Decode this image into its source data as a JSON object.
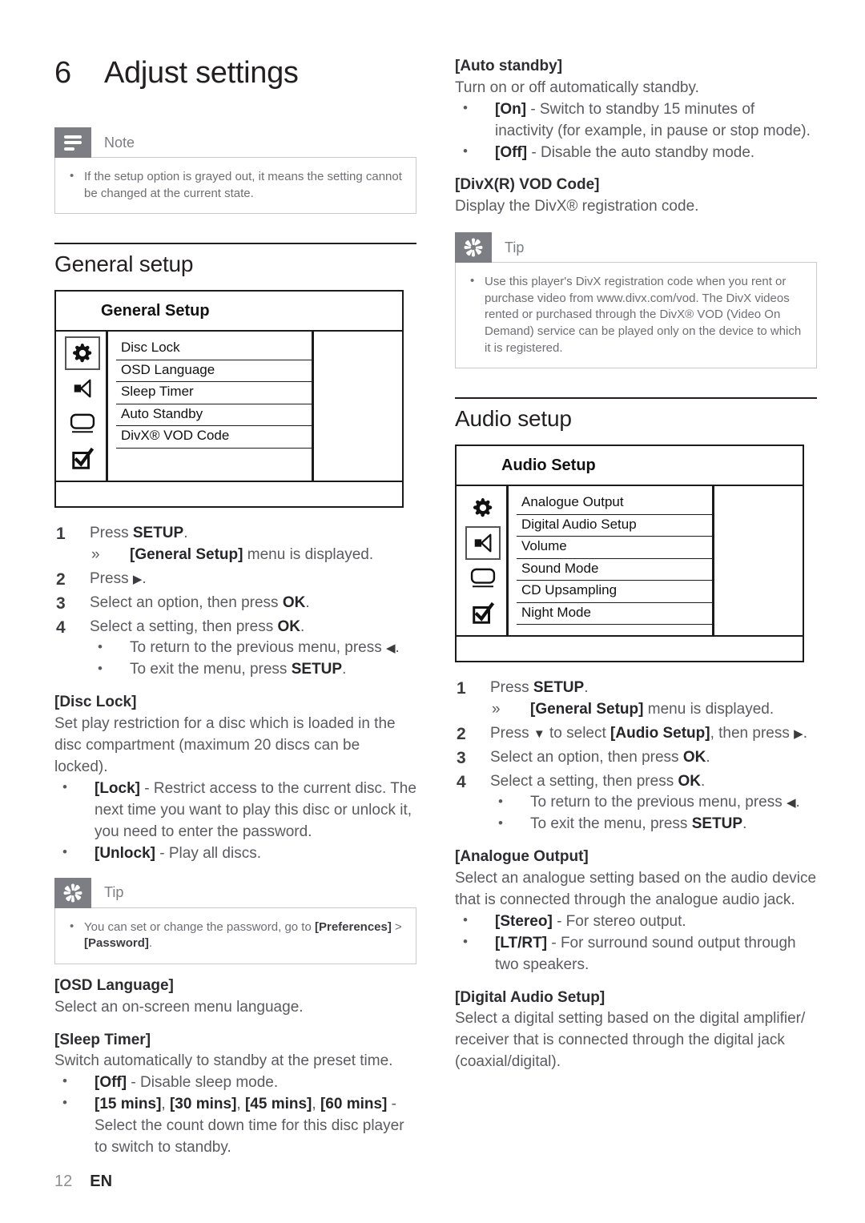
{
  "chapter": {
    "number": "6",
    "title": "Adjust settings"
  },
  "footer": {
    "page": "12",
    "language": "EN"
  },
  "note": {
    "label": "Note",
    "icon": "note-lines-icon",
    "items": [
      "If the setup option is grayed out, it means the setting cannot be changed at the current state."
    ]
  },
  "general_section": {
    "title": "General setup",
    "osd": {
      "title": "General Setup",
      "selected_icon_index": 0,
      "icons": [
        "gear-icon",
        "speaker-icon",
        "display-icon",
        "preferences-checkbox-icon"
      ],
      "items": [
        "Disc Lock",
        "OSD Language",
        "Sleep Timer",
        "Auto Standby",
        "DivX® VOD Code"
      ]
    },
    "steps": [
      {
        "text_html": "Press <b>SETUP</b>.",
        "subs": [
          {
            "marker": "»",
            "text_html": "<b>[General Setup]</b> menu is displayed."
          }
        ]
      },
      {
        "text_html": "Press <span class=\"arrow\">▶</span>.",
        "subs": []
      },
      {
        "text_html": "Select an option, then press <b>OK</b>.",
        "subs": []
      },
      {
        "text_html": "Select a setting, then press <b>OK</b>.",
        "subs": [
          {
            "marker": "•",
            "text_html": "To return to the previous menu, press <span class=\"arrow\">◀</span>."
          },
          {
            "marker": "•",
            "text_html": "To exit the menu, press <b>SETUP</b>."
          }
        ]
      }
    ],
    "options": [
      {
        "head": "[Disc Lock]",
        "body": "Set play restriction for a disc which is loaded in the disc compartment (maximum 20 discs can be locked).",
        "bullets": [
          "<b>[Lock]</b> - Restrict access to the current disc. The next time you want to play this disc or unlock it, you need to enter the password.",
          "<b>[Unlock]</b> - Play all discs."
        ]
      }
    ],
    "tip": {
      "label": "Tip",
      "icon": "starburst-icon",
      "items": [
        "You can set or change the password, go to <b>[Preferences]</b> > <b>[Password]</b>."
      ]
    },
    "options_after_tip": [
      {
        "head": "[OSD Language]",
        "body": "Select an on-screen menu language.",
        "bullets": []
      },
      {
        "head": "[Sleep Timer]",
        "body": "Switch automatically to standby at the preset time.",
        "bullets": [
          "<b>[Off]</b> - Disable sleep mode.",
          "<b>[15 mins]</b>, <b>[30 mins]</b>, <b>[45 mins]</b>, <b>[60 mins]</b> -Select the count down time for this disc player to switch to standby."
        ]
      }
    ]
  },
  "right_column": {
    "options_top": [
      {
        "head": "[Auto standby]",
        "body": "Turn on or off automatically standby.",
        "bullets": [
          "<b>[On]</b> - Switch to standby 15 minutes of inactivity (for example, in pause or stop mode).",
          "<b>[Off]</b> - Disable the auto standby mode."
        ]
      },
      {
        "head": "[DivX(R) VOD Code]",
        "body": "Display the DivX® registration code.",
        "bullets": []
      }
    ],
    "tip": {
      "label": "Tip",
      "icon": "starburst-icon",
      "items": [
        "Use this player's DivX registration code when you rent or purchase video from www.divx.com/vod. The DivX videos rented or purchased through the DivX® VOD (Video On Demand) service can be played only on the device to which it is registered."
      ]
    }
  },
  "audio_section": {
    "title": "Audio setup",
    "osd": {
      "title": "Audio Setup",
      "selected_icon_index": 1,
      "icons": [
        "gear-icon",
        "speaker-icon",
        "display-icon",
        "preferences-checkbox-icon"
      ],
      "items": [
        "Analogue Output",
        "Digital Audio Setup",
        "Volume",
        "Sound Mode",
        "CD Upsampling",
        "Night Mode"
      ]
    },
    "steps": [
      {
        "text_html": "Press <b>SETUP</b>.",
        "subs": [
          {
            "marker": "»",
            "text_html": "<b>[General Setup]</b> menu is displayed."
          }
        ]
      },
      {
        "text_html": "Press <span class=\"arrow\">▼</span> to select <b>[Audio Setup]</b>, then press <span class=\"arrow\">▶</span>.",
        "subs": []
      },
      {
        "text_html": "Select an option, then press <b>OK</b>.",
        "subs": []
      },
      {
        "text_html": "Select a setting, then press <b>OK</b>.",
        "subs": [
          {
            "marker": "•",
            "text_html": "To return to the previous menu, press <span class=\"arrow\">◀</span>."
          },
          {
            "marker": "•",
            "text_html": "To exit the menu, press <b>SETUP</b>."
          }
        ]
      }
    ],
    "options": [
      {
        "head": "[Analogue Output]",
        "body": "Select an analogue setting based on the audio device that is connected through the analogue audio jack.",
        "bullets": [
          "<b>[Stereo]</b> - For stereo output.",
          "<b>[LT/RT]</b> - For surround sound output through two speakers."
        ]
      },
      {
        "head": "[Digital Audio Setup]",
        "body": "Select a digital setting based on the digital amplifier/ receiver that is connected through the digital jack (coaxial/digital).",
        "bullets": []
      }
    ]
  }
}
